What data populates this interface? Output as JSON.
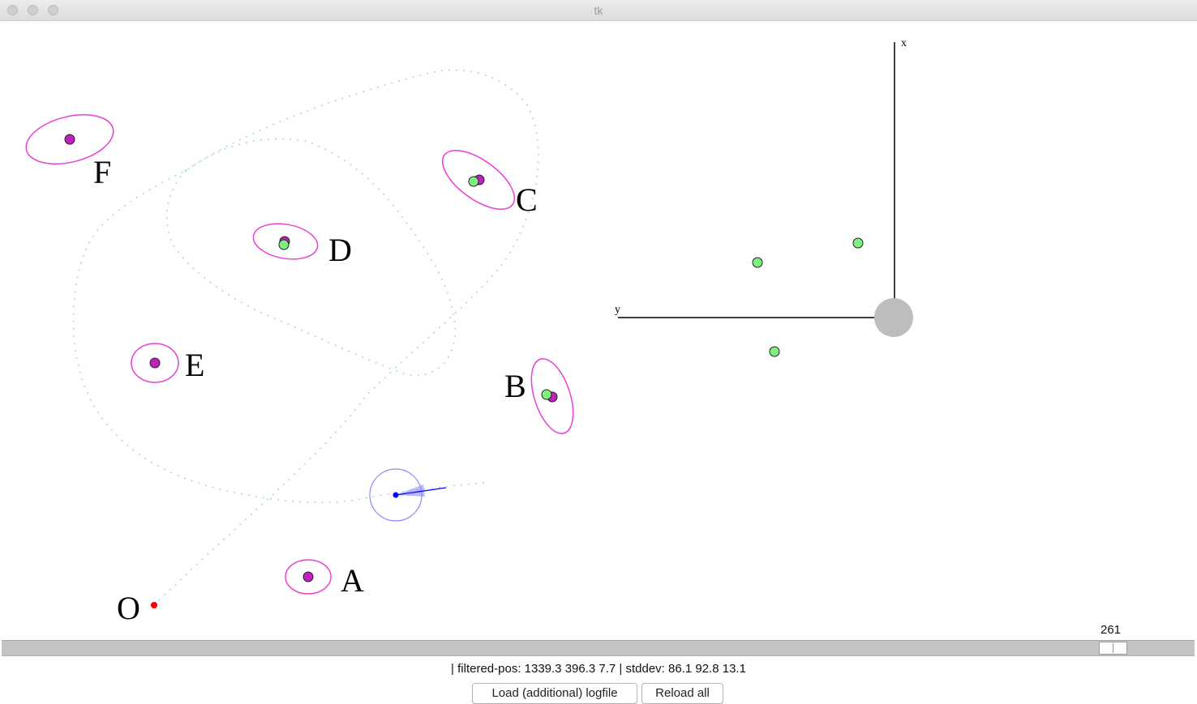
{
  "window": {
    "title": "tk"
  },
  "map": {
    "origin_label": "O",
    "beacons": [
      {
        "id": "A",
        "label": "A",
        "has_estimate": false
      },
      {
        "id": "B",
        "label": "B",
        "has_estimate": true
      },
      {
        "id": "C",
        "label": "C",
        "has_estimate": true
      },
      {
        "id": "D",
        "label": "D",
        "has_estimate": true
      },
      {
        "id": "E",
        "label": "E",
        "has_estimate": false
      },
      {
        "id": "F",
        "label": "F",
        "has_estimate": false
      }
    ]
  },
  "robot_view": {
    "x_axis_label": "x",
    "y_axis_label": "y",
    "detected_count": 3
  },
  "slider": {
    "value": "261"
  },
  "status": {
    "text": "| filtered-pos: 1339.3 396.3 7.7 | stddev: 86.1 92.8 13.1"
  },
  "buttons": {
    "load_label": "Load (additional) logfile",
    "reload_label": "Reload all"
  },
  "colors": {
    "trajectory": "#add8e6",
    "ellipse": "#e83fd5",
    "beacon": "#c020c0",
    "detected": "#7ef07e",
    "robot": "#0000ff",
    "origin": "#ff0000",
    "robot_body": "#bdbdbd"
  }
}
